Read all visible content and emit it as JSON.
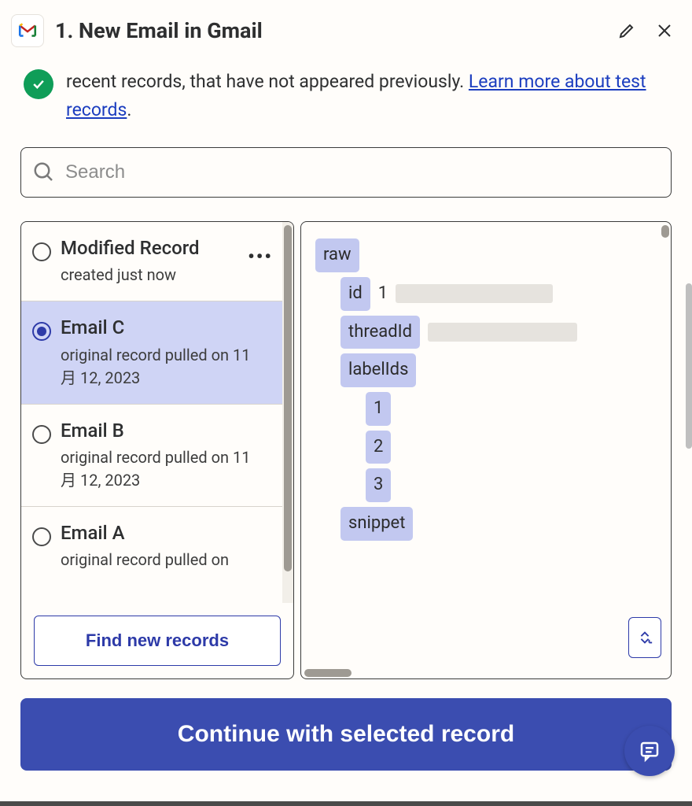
{
  "header": {
    "title": "1. New Email in Gmail"
  },
  "info": {
    "text_before": "recent records, that have not appeared previously. ",
    "link_text": "Learn more about test records",
    "text_after": "."
  },
  "search": {
    "placeholder": "Search"
  },
  "records": [
    {
      "title": "Modified Record",
      "subtitle": "created just now",
      "selected": false
    },
    {
      "title": "Email C",
      "subtitle": "original record pulled on 11 月 12, 2023",
      "selected": true
    },
    {
      "title": "Email B",
      "subtitle": "original record pulled on 11 月 12, 2023",
      "selected": false
    },
    {
      "title": "Email A",
      "subtitle": "original record pulled on",
      "selected": false
    }
  ],
  "detail": {
    "keys": {
      "raw": "raw",
      "id": "id",
      "threadId": "threadId",
      "labelIds": "labelIds",
      "snippet": "snippet"
    },
    "id_prefix": "1",
    "labelIndices": [
      "1",
      "2",
      "3"
    ]
  },
  "buttons": {
    "find_new_records": "Find new records",
    "continue": "Continue with selected record"
  }
}
